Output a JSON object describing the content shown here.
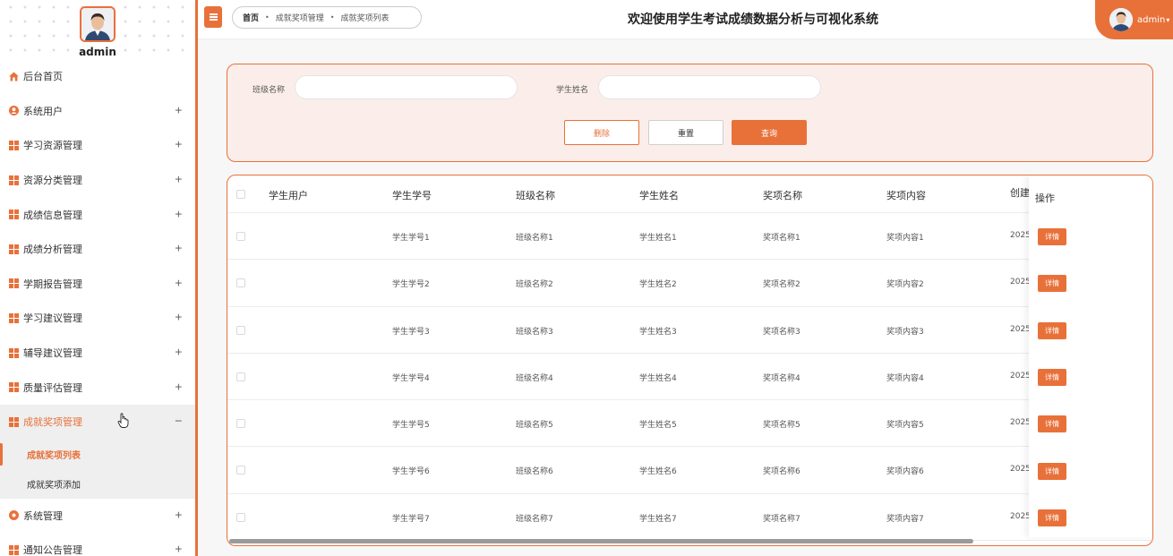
{
  "sidebar": {
    "username": "admin",
    "items": [
      {
        "label": "后台首页",
        "icon": "home-icon",
        "expand": ""
      },
      {
        "label": "系统用户",
        "icon": "user-circle-icon",
        "expand": "+"
      },
      {
        "label": "学习资源管理",
        "icon": "grid-icon",
        "expand": "+"
      },
      {
        "label": "资源分类管理",
        "icon": "grid-icon",
        "expand": "+"
      },
      {
        "label": "成绩信息管理",
        "icon": "grid-icon",
        "expand": "+"
      },
      {
        "label": "成绩分析管理",
        "icon": "grid-icon",
        "expand": "+"
      },
      {
        "label": "学期报告管理",
        "icon": "grid-icon",
        "expand": "+"
      },
      {
        "label": "学习建议管理",
        "icon": "grid-icon",
        "expand": "+"
      },
      {
        "label": "辅导建议管理",
        "icon": "grid-icon",
        "expand": "+"
      },
      {
        "label": "质量评估管理",
        "icon": "grid-icon",
        "expand": "+"
      },
      {
        "label": "成就奖项管理",
        "icon": "grid-icon",
        "expand": "−"
      }
    ],
    "subitems": [
      {
        "label": "成就奖项列表"
      },
      {
        "label": "成就奖项添加"
      }
    ],
    "after_items": [
      {
        "label": "系统管理",
        "icon": "gear-icon",
        "expand": "+"
      },
      {
        "label": "通知公告管理",
        "icon": "grid-icon",
        "expand": "+"
      }
    ]
  },
  "header": {
    "title": "欢迎使用学生考试成绩数据分析与可视化系统",
    "breadcrumb": [
      "首页",
      "成就奖项管理",
      "成就奖项列表"
    ],
    "user_name": "admin",
    "caret": "▾"
  },
  "search": {
    "class_label": "班级名称",
    "class_value": "",
    "student_label": "学生姓名",
    "student_value": "",
    "delete_label": "删除",
    "reset_label": "重置",
    "query_label": "查询"
  },
  "table": {
    "headers": [
      "学生用户",
      "学生学号",
      "班级名称",
      "学生姓名",
      "奖项名称",
      "奖项内容",
      "创建"
    ],
    "op_header": "操作",
    "detail_label": "详情",
    "rows": [
      [
        "",
        "学生学号1",
        "班级名称1",
        "学生姓名1",
        "奖项名称1",
        "奖项内容1",
        "2025"
      ],
      [
        "",
        "学生学号2",
        "班级名称2",
        "学生姓名2",
        "奖项名称2",
        "奖项内容2",
        "2025"
      ],
      [
        "",
        "学生学号3",
        "班级名称3",
        "学生姓名3",
        "奖项名称3",
        "奖项内容3",
        "2025"
      ],
      [
        "",
        "学生学号4",
        "班级名称4",
        "学生姓名4",
        "奖项名称4",
        "奖项内容4",
        "2025"
      ],
      [
        "",
        "学生学号5",
        "班级名称5",
        "学生姓名5",
        "奖项名称5",
        "奖项内容5",
        "2025"
      ],
      [
        "",
        "学生学号6",
        "班级名称6",
        "学生姓名6",
        "奖项名称6",
        "奖项内容6",
        "2025"
      ],
      [
        "",
        "学生学号7",
        "班级名称7",
        "学生姓名7",
        "奖项名称7",
        "奖项内容7",
        "2025"
      ]
    ]
  },
  "colors": {
    "accent": "#e8713a",
    "panel_bg": "#fbeeea"
  }
}
